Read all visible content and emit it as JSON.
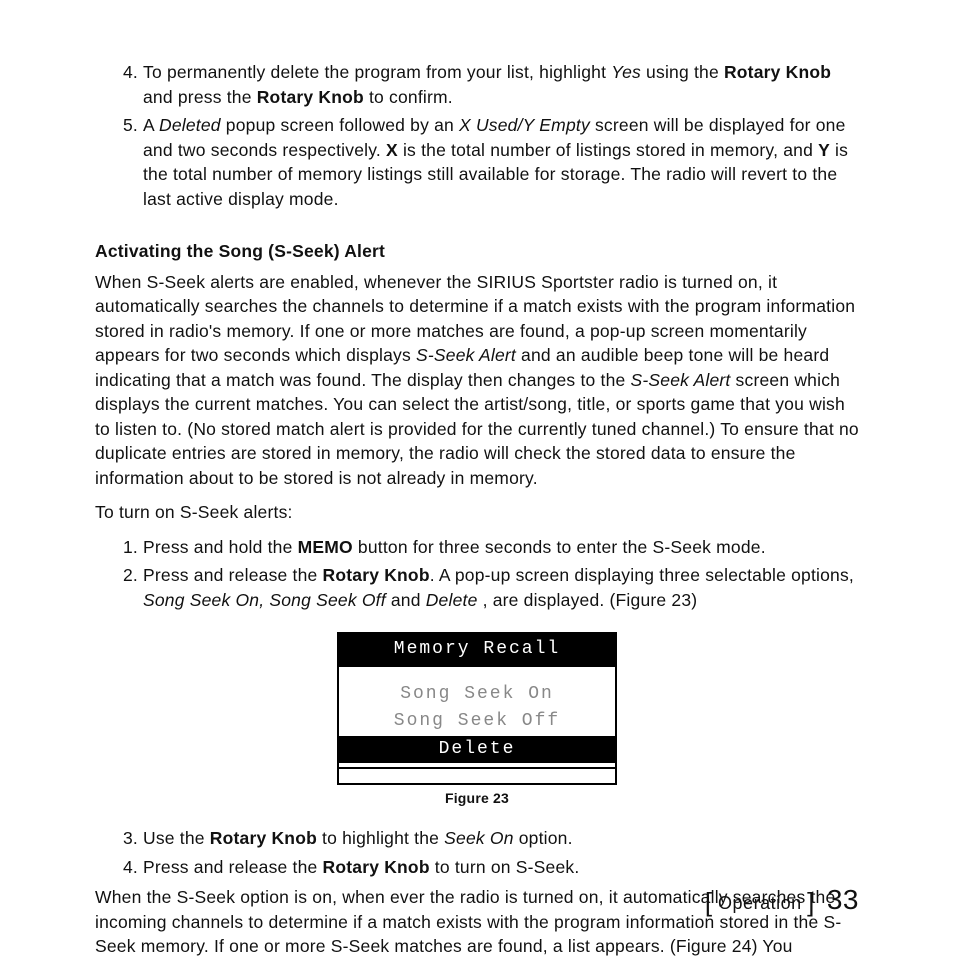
{
  "list1": {
    "item4": {
      "pre": "To permanently delete the program from your list, highlight ",
      "yes": "Yes",
      "mid": " using the ",
      "rk": "Rotary Knob",
      "mid2": " and press the ",
      "rk2": "Rotary Knob",
      "end": " to confirm."
    },
    "item5": {
      "pre": "A ",
      "del": "Deleted",
      "mid": " popup screen followed by an ",
      "xy": "X Used/Y Empty",
      "mid2": " screen will be displayed for one and two seconds respectively. ",
      "x": "X",
      "mid3": " is the total number of listings stored in memory, and ",
      "y": "Y",
      "end": " is the total number of memory listings still available for storage. The radio will revert to the last active display mode."
    }
  },
  "heading": "Activating the Song (S-Seek) Alert",
  "para1": {
    "a": "When S-Seek alerts are enabled, whenever the SIRIUS Sportster radio is turned on, it automatically searches the channels to determine if a match exists with the program information stored in radio's memory. If one or more matches are found, a pop-up screen momentarily appears for two seconds which displays ",
    "b": "S-Seek Alert",
    "c": " and an audible beep tone will be heard indicating that a match was found. The display then changes to the ",
    "d": "S-Seek Alert",
    "e": " screen which displays the current matches. You can select the artist/song, title, or sports game that you wish to listen to. (No stored match alert is provided for the currently tuned channel.) To ensure that no duplicate entries are stored in memory, the radio will check the stored data to ensure the information about to be stored is not already in memory."
  },
  "para2": "To turn on S-Seek alerts:",
  "list2": {
    "item1": {
      "a": "Press and hold the ",
      "b": "MEMO",
      "c": " button for three seconds to enter the S-Seek mode."
    },
    "item2": {
      "a": "Press and release the ",
      "b": "Rotary Knob",
      "c": ". A pop-up screen displaying three selectable options, ",
      "d": "Song Seek On, Song Seek Off",
      "e": " and ",
      "f": "Delete",
      "g": " , are displayed. (Figure 23)"
    }
  },
  "lcd": {
    "title": "Memory Recall",
    "opt1": "Song Seek On",
    "opt2": "Song Seek Off",
    "opt3": "Delete"
  },
  "caption": "Figure 23",
  "list3": {
    "item3": {
      "a": "Use the ",
      "b": "Rotary Knob",
      "c": " to highlight the ",
      "d": "Seek On",
      "e": " option."
    },
    "item4": {
      "a": "Press and release the ",
      "b": "Rotary Knob",
      "c": " to turn on S-Seek."
    }
  },
  "para3": "When the S-Seek option is on, when ever the radio is turned on, it automatically searches the incoming channels to determine if a match exists with the program information stored in the S-Seek memory. If one or more S-Seek matches are found, a list appears. (Figure 24) You",
  "footer": {
    "bracket_l": "[",
    "section": " Operation ",
    "bracket_r": "]",
    "page": "33"
  }
}
